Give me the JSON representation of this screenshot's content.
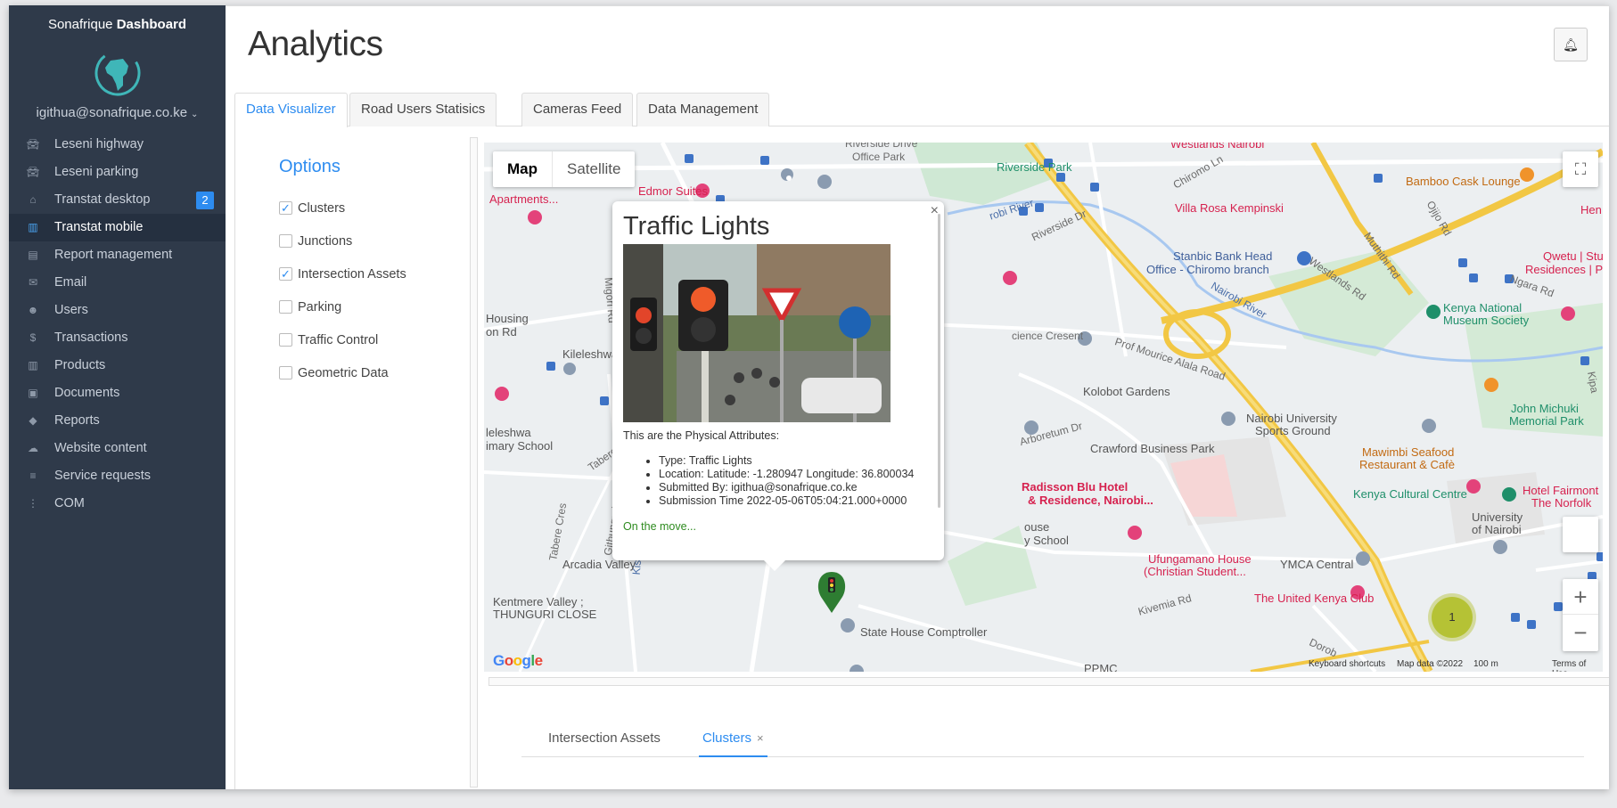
{
  "brand": {
    "name": "Sonafrique",
    "suffix": "Dashboard"
  },
  "user": {
    "email": "igithua@sonafrique.co.ke"
  },
  "sidebar": {
    "items": [
      {
        "label": "Leseni highway",
        "icon": "car-icon"
      },
      {
        "label": "Leseni parking",
        "icon": "car-icon"
      },
      {
        "label": "Transtat desktop",
        "icon": "home-icon",
        "badge": "2"
      },
      {
        "label": "Transtat mobile",
        "icon": "bar-chart-icon",
        "active": true
      },
      {
        "label": "Report management",
        "icon": "inbox-icon"
      },
      {
        "label": "Email",
        "icon": "envelope-icon"
      },
      {
        "label": "Users",
        "icon": "users-icon"
      },
      {
        "label": "Transactions",
        "icon": "dollar-icon"
      },
      {
        "label": "Products",
        "icon": "barcode-icon"
      },
      {
        "label": "Documents",
        "icon": "book-icon"
      },
      {
        "label": "Reports",
        "icon": "tag-icon"
      },
      {
        "label": "Website content",
        "icon": "cloud-upload-icon"
      },
      {
        "label": "Service requests",
        "icon": "database-icon"
      },
      {
        "label": "COM",
        "icon": "more-vertical-icon"
      }
    ]
  },
  "header": {
    "title": "Analytics"
  },
  "tabs": [
    "Data Visualizer",
    "Road Users Statisics",
    "Cameras Feed",
    "Data Management"
  ],
  "options": {
    "title": "Options",
    "items": [
      {
        "label": "Clusters",
        "checked": true
      },
      {
        "label": "Junctions",
        "checked": false
      },
      {
        "label": "Intersection Assets",
        "checked": true
      },
      {
        "label": "Parking",
        "checked": false
      },
      {
        "label": "Traffic Control",
        "checked": false
      },
      {
        "label": "Geometric Data",
        "checked": false
      }
    ]
  },
  "map": {
    "type_buttons": [
      "Map",
      "Satellite"
    ],
    "google": "Google",
    "attribution": {
      "shortcuts": "Keyboard shortcuts",
      "data": "Map data ©2022",
      "scale": "100 m",
      "terms": "Terms of Use"
    },
    "cluster_count": "1",
    "labels": {
      "westlands": "Westlands Nairobi",
      "riverside_drive": "Riverside Drive",
      "office_park": "Office Park",
      "riverside_park": "Riverside Park",
      "bamboo": "Bamboo Cask Lounge",
      "hen": "Hen",
      "edmor": "Edmor Suites",
      "apartments": "Apartments...",
      "villa_rosa": "Villa Rosa Kempinski",
      "stanbic1": "Stanbic Bank Head",
      "stanbic2": "Office - Chiromo branch",
      "qwetu1": "Qwetu | Stud",
      "qwetu2": "Residences | Parklar",
      "kenya_museum1": "Kenya National",
      "kenya_museum2": "Museum Society",
      "housing": "Housing",
      "on_rd": "on Rd",
      "kileleshwa": "Kileleshwa P",
      "science": "cience Cresent",
      "kolobot": "Kolobot Gardens",
      "nairobi_uni1": "Nairobi University",
      "nairobi_uni2": "Sports Ground",
      "john_michuki1": "John Michuki",
      "john_michuki2": "Memorial Park",
      "leleshwa": "leleshwa",
      "mary_school": "imary School",
      "crawford": "Crawford Business Park",
      "mawimbi1": "Mawimbi Seafood",
      "mawimbi2": "Restaurant & Cafè",
      "radisson1": "Radisson Blu Hotel",
      "radisson2": "& Residence, Nairobi...",
      "kenya_cultural": "Kenya Cultural Centre",
      "fairmont1": "Hotel Fairmont",
      "fairmont2": "The Norfolk",
      "university1": "University",
      "university2": "of Nairobi",
      "ouse": "ouse",
      "y_school": "y School",
      "arcadia": "Arcadia Valley",
      "ufungamano1": "Ufungamano House",
      "ufungamano2": "(Christian Student...",
      "ymca": "YMCA Central",
      "kentmere1": "Kentmere Valley ;",
      "kentmere2": "THUNGURI CLOSE",
      "kenya_club": "The United Kenya Club",
      "state_house": "State House Comptroller",
      "ppmc": "PPMC",
      "nairobi_river": "Nairobi River",
      "robi_river": "robi River",
      "chiromo_ln": "Chiromo Ln",
      "riverside_dr": "Riverside Dr",
      "westlands_rd": "Westlands Rd",
      "muthithi": "Muthithi Rd",
      "ojijo": "Ojijo Rd",
      "ngara": "Ngara Rd",
      "prof_mourice": "Prof Mourice Alala Road",
      "arboretum": "Arboretum Dr",
      "migori": "Migori Rd",
      "tabere": "Tabere Cres",
      "githunguri": "Githunguri Rd",
      "kivemia": "Kivemia Rd",
      "dorobo": "Dorob",
      "kisi": "Kis",
      "kipan": "Kipa"
    },
    "info_window": {
      "title": "Traffic Lights",
      "intro": "This are the Physical Attributes:",
      "attributes": [
        "Type: Traffic Lights",
        "Location: Latitude: -1.280947 Longitude: 36.800034",
        "Submitted By: igithua@sonafrique.co.ke",
        "Submission Time 2022-05-06T05:04:21.000+0000"
      ],
      "footer": "On the move...",
      "sign_text": "GIVE WAY"
    }
  },
  "bottom_tabs": [
    {
      "label": "Intersection Assets",
      "active": false
    },
    {
      "label": "Clusters",
      "active": true,
      "close": "×"
    }
  ],
  "colors": {
    "sidebar_bg": "#2f3a4a",
    "accent": "#2d8cf0",
    "road_yellow": "#f2c744",
    "marker_green": "#2e7d32"
  }
}
